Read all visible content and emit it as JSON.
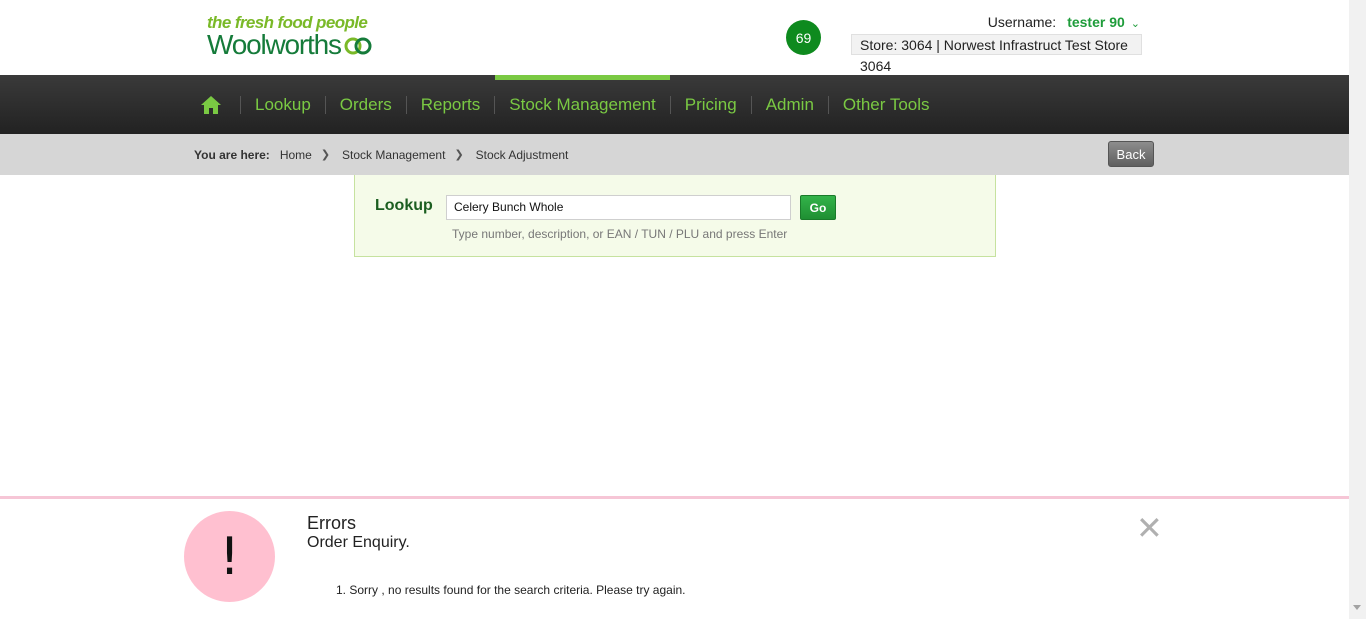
{
  "header": {
    "tagline": "the fresh food people",
    "brand": "Woolworths",
    "notification_count": "69",
    "username_label": "Username:",
    "username": "tester 90",
    "store": "Store: 3064 | Norwest Infrastruct Test Store 3064"
  },
  "nav": {
    "items": [
      {
        "label": "Lookup"
      },
      {
        "label": "Orders"
      },
      {
        "label": "Reports"
      },
      {
        "label": "Stock Management",
        "active": true
      },
      {
        "label": "Pricing"
      },
      {
        "label": "Admin"
      },
      {
        "label": "Other Tools"
      }
    ]
  },
  "breadcrumb": {
    "prefix": "You are here:",
    "items": [
      "Home",
      "Stock Management",
      "Stock Adjustment"
    ],
    "back_label": "Back"
  },
  "lookup": {
    "label": "Lookup",
    "value": "Celery Bunch Whole",
    "go_label": "Go",
    "hint": "Type number, description, or EAN / TUN / PLU and press Enter"
  },
  "error": {
    "title": "Errors",
    "subtitle": "Order Enquiry.",
    "messages": [
      "1. Sorry , no results found for the search criteria. Please try again."
    ],
    "icon_symbol": "!"
  },
  "colors": {
    "brand_green": "#157b3a",
    "nav_green": "#7ac943",
    "error_pink": "#ffc0d0"
  }
}
